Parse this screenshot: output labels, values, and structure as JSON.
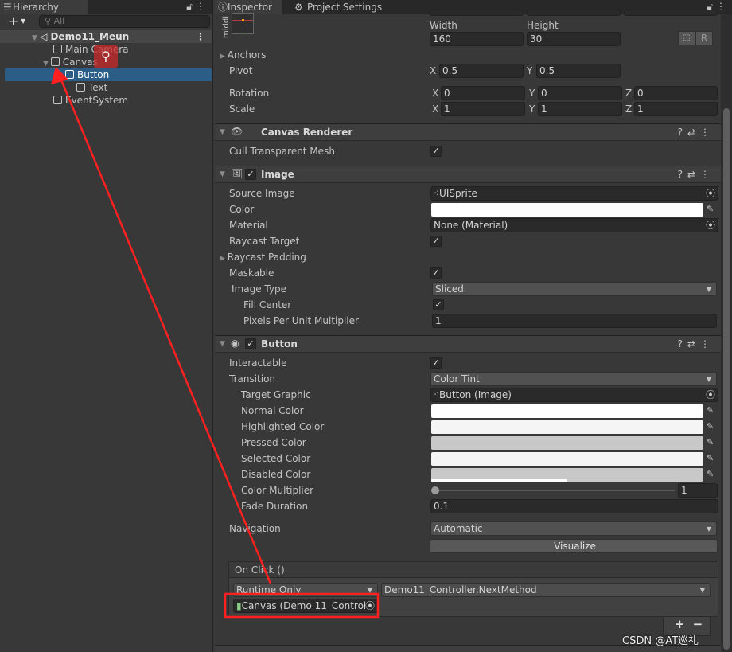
{
  "hierarchy": {
    "tab": "Hierarchy",
    "add_label": "+",
    "search_placeholder": "All",
    "scene": "Demo11_Meun",
    "items": [
      {
        "label": "Main Camera"
      },
      {
        "label": "Canvas"
      },
      {
        "label": "Button",
        "selected": true
      },
      {
        "label": "Text"
      },
      {
        "label": "EventSystem"
      }
    ]
  },
  "inspector": {
    "tabs": [
      "Inspector",
      "Project Settings"
    ],
    "rect": {
      "anchor_preset": "middl",
      "width_label": "Width",
      "height_label": "Height",
      "width": "160",
      "height": "30",
      "r_label": "R",
      "anchors": "Anchors",
      "pivot": {
        "label": "Pivot",
        "x": "0.5",
        "y": "0.5"
      },
      "rotation": {
        "label": "Rotation",
        "x": "0",
        "y": "0",
        "z": "0"
      },
      "scale": {
        "label": "Scale",
        "x": "1",
        "y": "1",
        "z": "1"
      },
      "axes": {
        "x": "X",
        "y": "Y",
        "z": "Z"
      }
    },
    "canvas_renderer": {
      "title": "Canvas Renderer",
      "cull_label": "Cull Transparent Mesh",
      "cull": true
    },
    "image": {
      "title": "Image",
      "enabled": true,
      "source_image_label": "Source Image",
      "source_image": "UISprite",
      "color_label": "Color",
      "color": "#ffffff",
      "material_label": "Material",
      "material": "None (Material)",
      "raycast_target_label": "Raycast Target",
      "raycast_target": true,
      "raycast_padding_label": "Raycast Padding",
      "maskable_label": "Maskable",
      "maskable": true,
      "image_type_label": "Image Type",
      "image_type": "Sliced",
      "fill_center_label": "Fill Center",
      "fill_center": true,
      "ppu_label": "Pixels Per Unit Multiplier",
      "ppu": "1"
    },
    "button": {
      "title": "Button",
      "enabled": true,
      "interactable_label": "Interactable",
      "interactable": true,
      "transition_label": "Transition",
      "transition": "Color Tint",
      "target_graphic_label": "Target Graphic",
      "target_graphic": "Button (Image)",
      "colors": [
        {
          "label": "Normal Color",
          "value": "#ffffff"
        },
        {
          "label": "Highlighted Color",
          "value": "#f5f5f5"
        },
        {
          "label": "Pressed Color",
          "value": "#c8c8c8"
        },
        {
          "label": "Selected Color",
          "value": "#f5f5f5"
        },
        {
          "label": "Disabled Color",
          "value": "#c8c8c8"
        }
      ],
      "color_multiplier_label": "Color Multiplier",
      "color_multiplier": "1",
      "fade_duration_label": "Fade Duration",
      "fade_duration": "0.1",
      "navigation_label": "Navigation",
      "navigation": "Automatic",
      "visualize_label": "Visualize",
      "on_click": {
        "title": "On Click ()",
        "mode": "Runtime Only",
        "function": "Demo11_Controller.NextMethod",
        "target": "Canvas (Demo 11_Controll",
        "add": "+",
        "remove": "−"
      }
    }
  },
  "watermark": "CSDN @AT巡礼",
  "annotation_color": "#ff2020"
}
